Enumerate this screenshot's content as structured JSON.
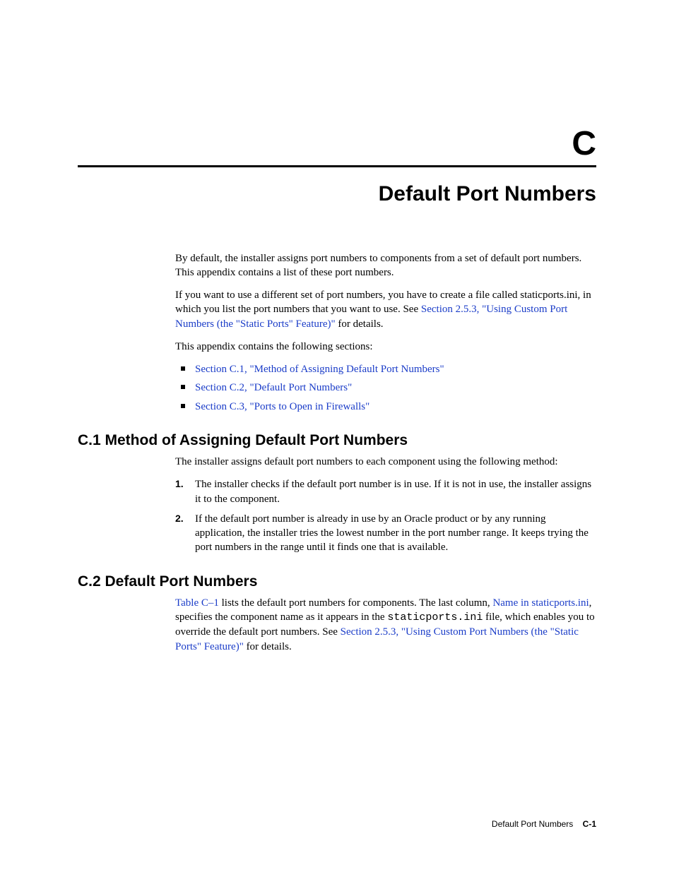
{
  "appendix_letter": "C",
  "chapter_title": "Default Port Numbers",
  "intro": {
    "p1": "By default, the installer assigns port numbers to components from a set of default port numbers. This appendix contains a list of these port numbers.",
    "p2a": "If you want to use a different set of port numbers, you have to create a file called staticports.ini, in which you list the port numbers that you want to use. See ",
    "p2_link": "Section 2.5.3, \"Using Custom Port Numbers (the \"Static Ports\" Feature)\"",
    "p2b": " for details.",
    "p3": "This appendix contains the following sections:"
  },
  "toc": [
    "Section C.1, \"Method of Assigning Default Port Numbers\"",
    "Section C.2, \"Default Port Numbers\"",
    "Section C.3, \"Ports to Open in Firewalls\""
  ],
  "c1": {
    "heading": "C.1  Method of Assigning Default Port Numbers",
    "intro": "The installer assigns default port numbers to each component using the following method:",
    "steps": [
      "The installer checks if the default port number is in use. If it is not in use, the installer assigns it to the component.",
      "If the default port number is already in use by an Oracle product or by any running application, the installer tries the lowest number in the port number range. It keeps trying the port numbers in the range until it finds one that is available."
    ]
  },
  "c2": {
    "heading": "C.2  Default Port Numbers",
    "p_a": "",
    "link_table": "Table C–1",
    "p_b": " lists the default port numbers for components. The last column, ",
    "link_name": "Name in staticports.ini",
    "p_c": ", specifies the component name as it appears in the ",
    "code": "staticports.ini",
    "p_d": " file, which enables you to override the default port numbers. See ",
    "link_sec": "Section 2.5.3, \"Using Custom Port Numbers (the \"Static Ports\" Feature)\"",
    "p_e": " for details."
  },
  "footer": {
    "title": "Default Port Numbers",
    "pageno": "C-1"
  }
}
